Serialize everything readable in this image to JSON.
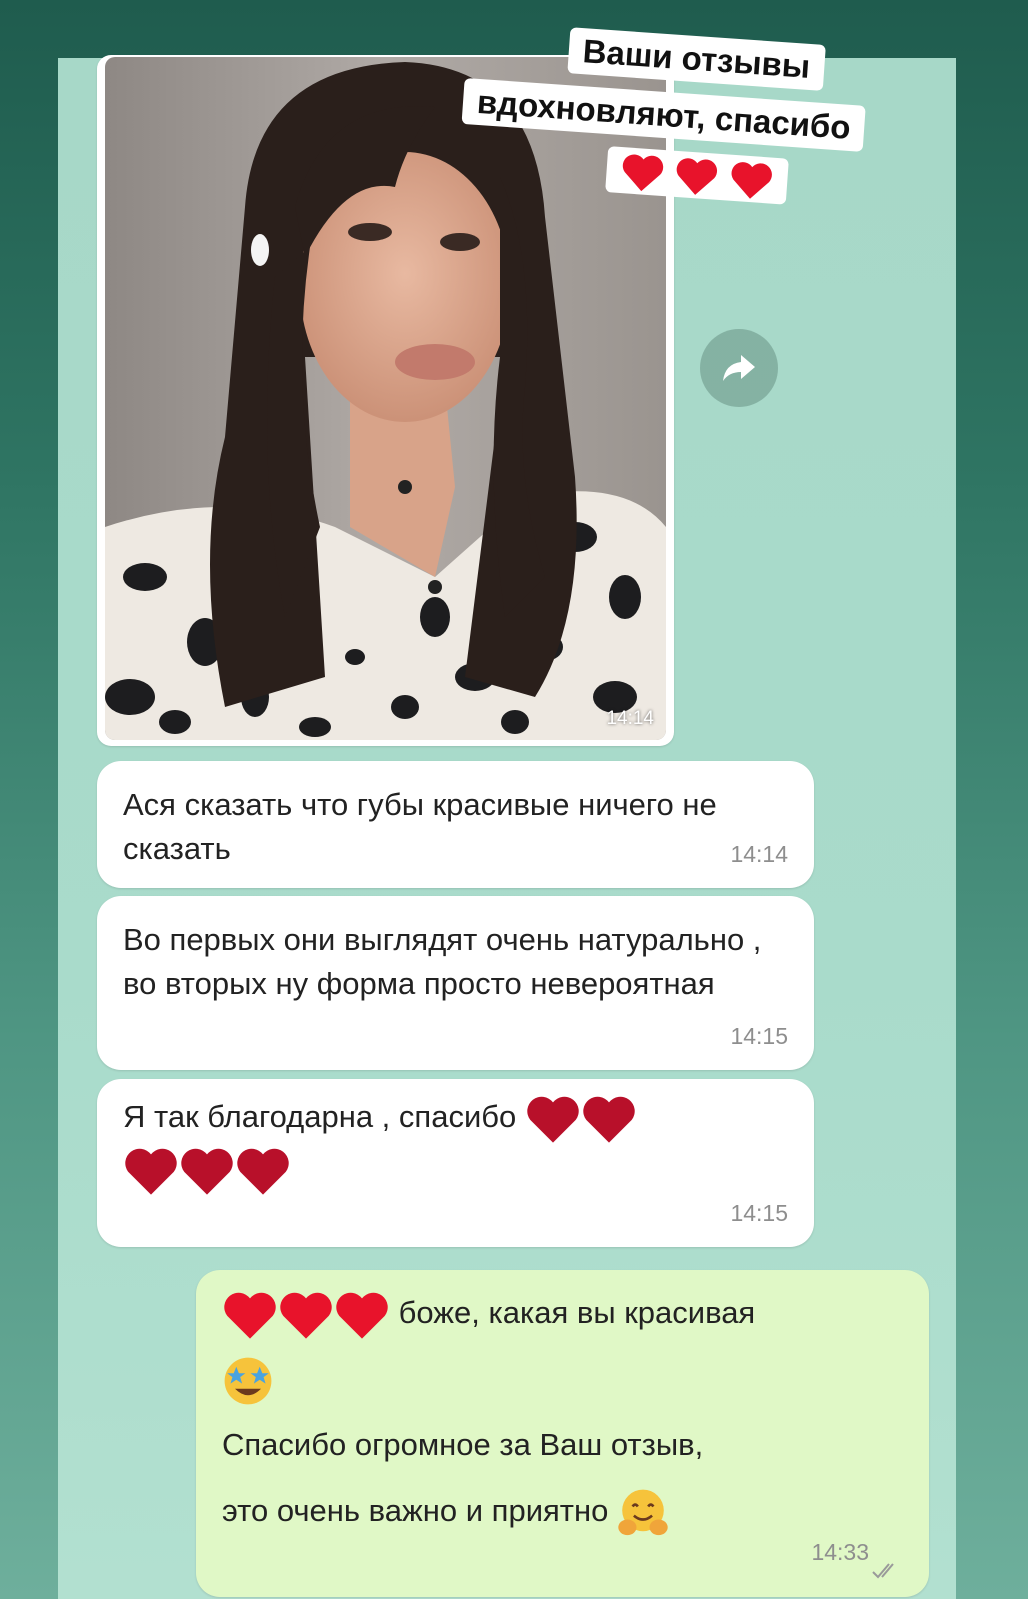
{
  "sticker": {
    "line1": "Ваши отзывы",
    "line2": "вдохновляют, спасибо",
    "line3_icons": "heart-icon x3"
  },
  "photo_message": {
    "time": "14:14"
  },
  "messages": [
    {
      "text": "Ася сказать что губы красивые ничего не сказать",
      "time": "14:14"
    },
    {
      "text": "Во первых они выглядят очень натурально , во вторых ну форма просто невероятная",
      "time": "14:15"
    },
    {
      "text": "Я так благодарна , спасибо",
      "time": "14:15"
    }
  ],
  "outgoing": {
    "line1": "боже, какая вы красивая",
    "line2": "Спасибо огромное за Ваш отзыв,",
    "line3": "это очень важно и приятно",
    "time": "14:33",
    "status_icon": "double-check-icon"
  },
  "colors": {
    "incoming_bubble": "#ffffff",
    "outgoing_bubble": "#e0f8c6",
    "chat_background": "#a7d8c8",
    "heart": "#c8102e"
  }
}
